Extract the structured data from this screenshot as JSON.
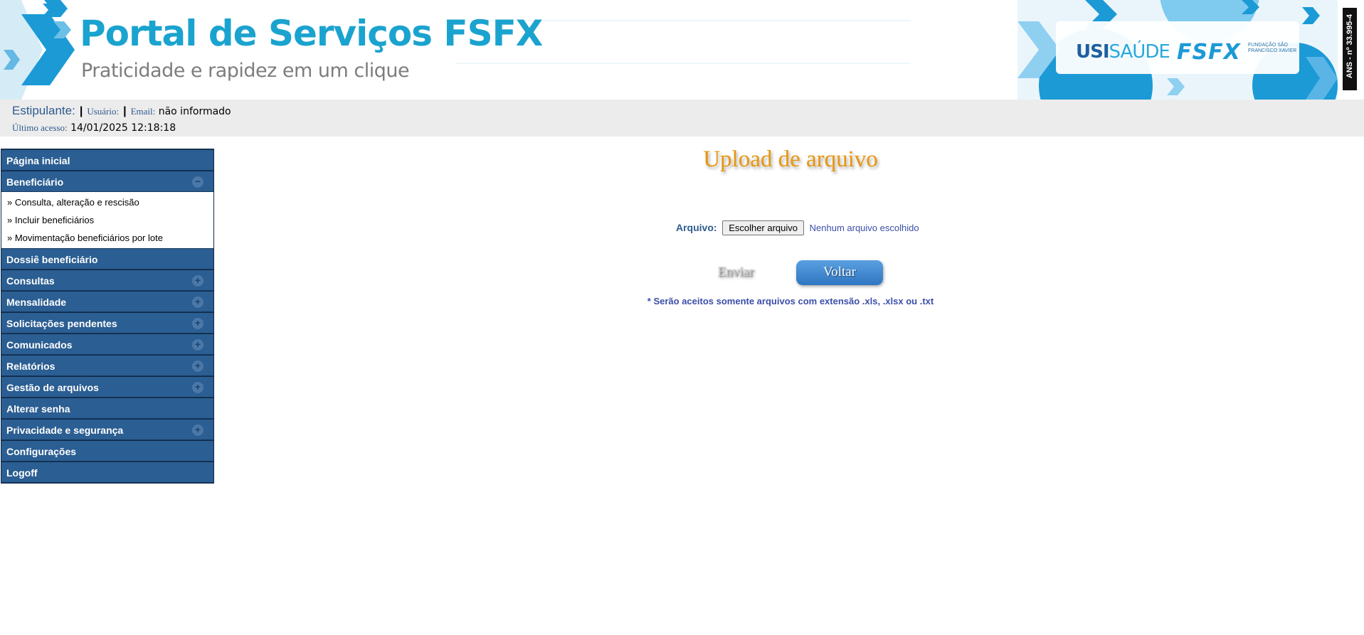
{
  "header": {
    "portal_title": "Portal de Serviços FSFX",
    "portal_subtitle": "Praticidade e rapidez em um clique",
    "logo_usi_strong": "USI",
    "logo_usi_light": "SAÚDE",
    "logo_fsfx": "FSFX",
    "logo_fundacao": "FUNDAÇÃO SÃO FRANCISCO XAVIER",
    "ans_label": "ANS - nº 33.995-4"
  },
  "info_bar": {
    "estipulante_label": "Estipulante:",
    "usuario_label": "Usuário:",
    "email_label": "Email:",
    "email_value": "não informado",
    "ultimo_acesso_label": "Último acesso:",
    "ultimo_acesso_value": "14/01/2025 12:18:18"
  },
  "sidebar": {
    "items": [
      {
        "label": "Página inicial",
        "toggle": null
      },
      {
        "label": "Beneficiário",
        "toggle": "−",
        "children": [
          {
            "label": "» Consulta, alteração e rescisão"
          },
          {
            "label": "» Incluir beneficiários"
          },
          {
            "label": "» Movimentação beneficiários por lote"
          }
        ]
      },
      {
        "label": "Dossiê beneficiário",
        "toggle": null
      },
      {
        "label": "Consultas",
        "toggle": "+"
      },
      {
        "label": "Mensalidade",
        "toggle": "+"
      },
      {
        "label": "Solicitações pendentes",
        "toggle": "+"
      },
      {
        "label": "Comunicados",
        "toggle": "+"
      },
      {
        "label": "Relatórios",
        "toggle": "+"
      },
      {
        "label": "Gestão de arquivos",
        "toggle": "+"
      },
      {
        "label": "Alterar senha",
        "toggle": null
      },
      {
        "label": "Privacidade e segurança",
        "toggle": "+"
      },
      {
        "label": "Configurações",
        "toggle": null
      },
      {
        "label": "Logoff",
        "toggle": null
      }
    ]
  },
  "main": {
    "title": "Upload de arquivo",
    "file_label": "Arquivo:",
    "file_button": "Escolher arquivo",
    "file_status": "Nenhum arquivo escolhido",
    "enviar_label": "Enviar",
    "voltar_label": "Voltar",
    "note": "* Serão aceitos somente arquivos com extensão .xls, .xlsx ou .txt"
  },
  "colors": {
    "brand_blue": "#1ba3cf",
    "menu_bg": "#2b5e92",
    "title_orange": "#e8960c",
    "label_blue": "#2e5b8f"
  }
}
